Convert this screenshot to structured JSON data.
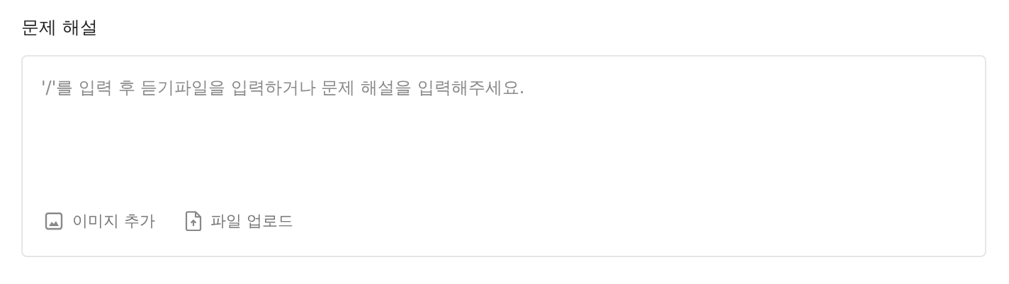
{
  "section": {
    "title": "문제 해설"
  },
  "editor": {
    "placeholder": "'/'를 입력 후 듣기파일을 입력하거나 문제 해설을 입력해주세요."
  },
  "actions": [
    {
      "kind": "image",
      "label": "이미지 추가"
    },
    {
      "kind": "file",
      "label": "파일 업로드"
    }
  ]
}
